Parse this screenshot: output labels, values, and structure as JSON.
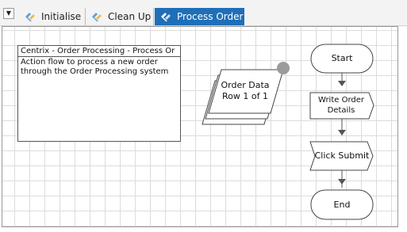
{
  "tabs": [
    {
      "label": "Initialise",
      "icon": "process-icon",
      "active": false
    },
    {
      "label": "Clean Up",
      "icon": "process-icon",
      "active": false
    },
    {
      "label": "Process Order",
      "icon": "process-icon",
      "active": true
    }
  ],
  "notes": {
    "title": "Centrix - Order Processing - Process Or",
    "body": "Action flow to process a new order through the Order Processing system"
  },
  "collection": {
    "line1": "Order Data",
    "line2": "Row 1 of 1"
  },
  "flow": {
    "start": "Start",
    "write_order_line1": "Write Order",
    "write_order_line2": "Details",
    "click_submit": "Click Submit",
    "end": "End"
  }
}
